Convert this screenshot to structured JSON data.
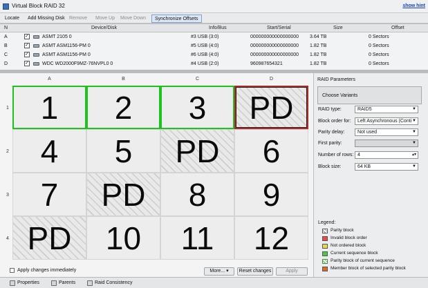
{
  "window": {
    "title": "Virtual Block RAID 32",
    "hint_link": "show hint"
  },
  "toolbar": {
    "locate": "Locate",
    "add_missing": "Add Missing Disk",
    "remove": "Remove",
    "move_up": "Move Up",
    "move_down": "Move Down",
    "synchronize": "Synchronize Offsets"
  },
  "disk_table": {
    "columns": {
      "n": "N",
      "device": "Device/Disk",
      "info": "Info/Bus",
      "serial": "Start/Serial",
      "size": "Size",
      "offset": "Offset"
    },
    "rows": [
      {
        "n": "A",
        "device": "ASMT 2105 0",
        "info": "#3 USB (3:0)",
        "serial": "000000000000000000",
        "size": "3.64 TB",
        "offset": "0 Sectors"
      },
      {
        "n": "B",
        "device": "ASMT ASM1156-PM 0",
        "info": "#5 USB (4:0)",
        "serial": "000000000000000000",
        "size": "1.82 TB",
        "offset": "0 Sectors"
      },
      {
        "n": "C",
        "device": "ASMT ASM1156-PM 0",
        "info": "#6 USB (4:0)",
        "serial": "000000000000000000",
        "size": "1.82 TB",
        "offset": "0 Sectors"
      },
      {
        "n": "D",
        "device": "WDC WD2000F9MZ-76NVPL0 0",
        "info": "#4 USB (2:0)",
        "serial": "960987654321",
        "size": "1.82 TB",
        "offset": "0 Sectors"
      }
    ]
  },
  "grid": {
    "columns": [
      "A",
      "B",
      "C",
      "D"
    ],
    "rows": [
      "1",
      "2",
      "3",
      "4"
    ],
    "cells": [
      [
        "1",
        "2",
        "3",
        "PD"
      ],
      [
        "4",
        "5",
        "PD",
        "6"
      ],
      [
        "7",
        "PD",
        "8",
        "9"
      ],
      [
        "PD",
        "10",
        "11",
        "12"
      ]
    ]
  },
  "bottom": {
    "apply_immediately": "Apply changes immediately",
    "more": "More...",
    "reset": "Reset changes",
    "apply": "Apply"
  },
  "raid_params": {
    "title": "RAID Parameters",
    "choose_variants": "Choose Variants",
    "raid_type_label": "RAID type:",
    "raid_type_value": "RAID5",
    "block_order_label": "Block order for:",
    "block_order_value": "Left Asynchronous (Conti",
    "parity_delay_label": "Parity delay:",
    "parity_delay_value": "Not used",
    "first_parity_label": "First parity:",
    "first_parity_value": "",
    "rows_label": "Number of rows:",
    "rows_value": "4",
    "block_size_label": "Block size:",
    "block_size_value": "64 KB"
  },
  "legend": {
    "title": "Legend:",
    "items": [
      {
        "label": "Parity block",
        "color": "#e8e8e8"
      },
      {
        "label": "Invalid block order",
        "color": "#e84a4a"
      },
      {
        "label": "Not ordered block",
        "color": "#e8d84a"
      },
      {
        "label": "Current sequence block",
        "color": "#4ac84a"
      },
      {
        "label": "Parity block of current sequence",
        "color": "#e8e8e8"
      },
      {
        "label": "Member block of selected parity block",
        "color": "#d86a2a"
      }
    ]
  },
  "tabs": {
    "properties": "Properties",
    "parents": "Parents",
    "raid_consistency": "Raid Consistency"
  }
}
